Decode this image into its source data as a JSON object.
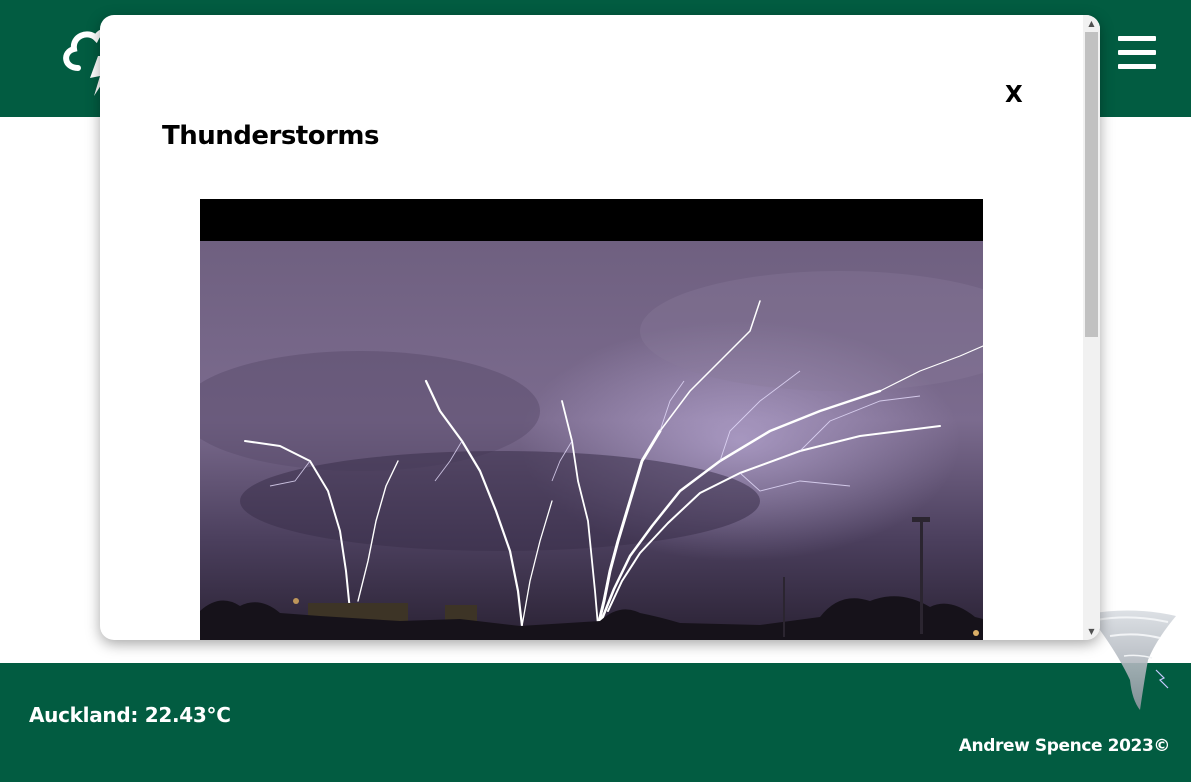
{
  "header": {
    "logo_icon": "storm-cloud-lightning-icon",
    "menu_icon": "hamburger-menu-icon"
  },
  "modal": {
    "close_label": "X",
    "title": "Thunderstorms",
    "image_subject": "lightning-storm-photo"
  },
  "footer": {
    "weather_text": "Auckland: 22.43°C",
    "copyright_text": "Andrew Spence 2023©",
    "decoration_icon": "tornado-icon"
  },
  "colors": {
    "brand_green": "#025c41",
    "modal_bg": "#ffffff",
    "text": "#000000"
  }
}
